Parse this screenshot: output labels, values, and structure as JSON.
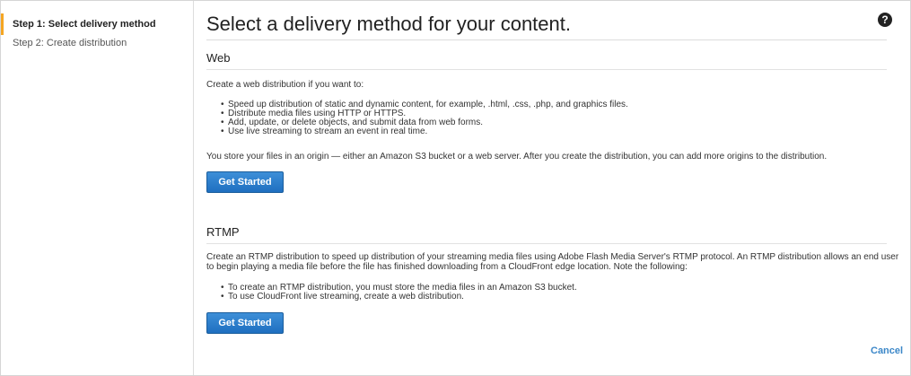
{
  "sidebar": {
    "steps": [
      {
        "label": "Step 1: Select delivery method"
      },
      {
        "label": "Step 2: Create distribution"
      }
    ]
  },
  "main": {
    "title": "Select a delivery method for your content.",
    "help_icon": "question-circle-icon",
    "web": {
      "heading": "Web",
      "intro": "Create a web distribution if you want to:",
      "bullets": [
        "Speed up distribution of static and dynamic content, for example, .html, .css, .php, and graphics files.",
        "Distribute media files using HTTP or HTTPS.",
        "Add, update, or delete objects, and submit data from web forms.",
        "Use live streaming to stream an event in real time."
      ],
      "note": "You store your files in an origin — either an Amazon S3 bucket or a web server. After you create the distribution, you can add more origins to the distribution.",
      "button": "Get Started"
    },
    "rtmp": {
      "heading": "RTMP",
      "intro": "Create an RTMP distribution to speed up distribution of your streaming media files using Adobe Flash Media Server's RTMP protocol. An RTMP distribution allows an end user to begin playing a media file before the file has finished downloading from a CloudFront edge location. Note the following:",
      "bullets": [
        "To create an RTMP distribution, you must store the media files in an Amazon S3 bucket.",
        "To use CloudFront live streaming, create a web distribution."
      ],
      "button": "Get Started"
    },
    "cancel": "Cancel"
  },
  "colors": {
    "accent_step": "#f5a623",
    "button": "#2a7dcd",
    "link": "#3b87c8"
  }
}
